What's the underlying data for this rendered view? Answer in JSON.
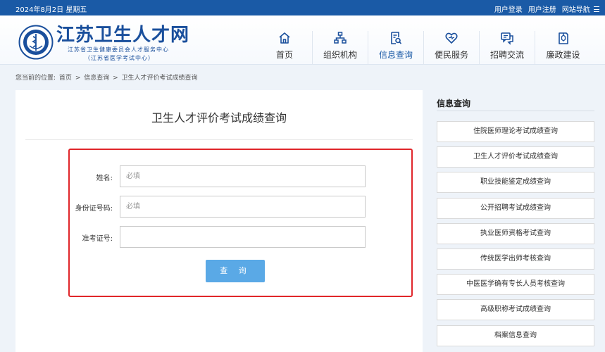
{
  "topbar": {
    "date": "2024年8月2日 星期五",
    "login": "用户登录",
    "register": "用户注册",
    "sitemap": "网站导航"
  },
  "brand": {
    "title": "江苏卫生人才网",
    "subtitle1": "江苏省卫生健康委员会人才服务中心",
    "subtitle2": "（江苏省医学考试中心）"
  },
  "nav": [
    {
      "label": "首页",
      "icon": "home-icon"
    },
    {
      "label": "组织机构",
      "icon": "org-chart-icon"
    },
    {
      "label": "信息查询",
      "icon": "search-doc-icon",
      "active": true
    },
    {
      "label": "便民服务",
      "icon": "heart-icon"
    },
    {
      "label": "招聘交流",
      "icon": "chat-icon"
    },
    {
      "label": "廉政建设",
      "icon": "shield-icon"
    }
  ],
  "breadcrumb": {
    "prefix": "您当前的位置:",
    "home": "首页",
    "sep": ">",
    "section": "信息查询",
    "current": "卫生人才评价考试成绩查询"
  },
  "main": {
    "title": "卫生人才评价考试成绩查询",
    "form": {
      "name_label": "姓名:",
      "name_placeholder": "必填",
      "id_label": "身份证号码:",
      "id_placeholder": "必填",
      "ticket_label": "准考证号:",
      "ticket_placeholder": "",
      "submit_label": "查 询"
    }
  },
  "side": {
    "title": "信息查询",
    "links": [
      "住院医师理论考试成绩查询",
      "卫生人才评价考试成绩查询",
      "职业技能鉴定成绩查询",
      "公开招聘考试成绩查询",
      "执业医师资格考试查询",
      "传统医学出师考核查询",
      "中医医学确有专长人员考核查询",
      "高级职称考试成绩查询",
      "档案信息查询"
    ]
  },
  "colors": {
    "primary": "#1a5aa6",
    "button": "#5aa9e6",
    "highlight_border": "#e0262a"
  }
}
